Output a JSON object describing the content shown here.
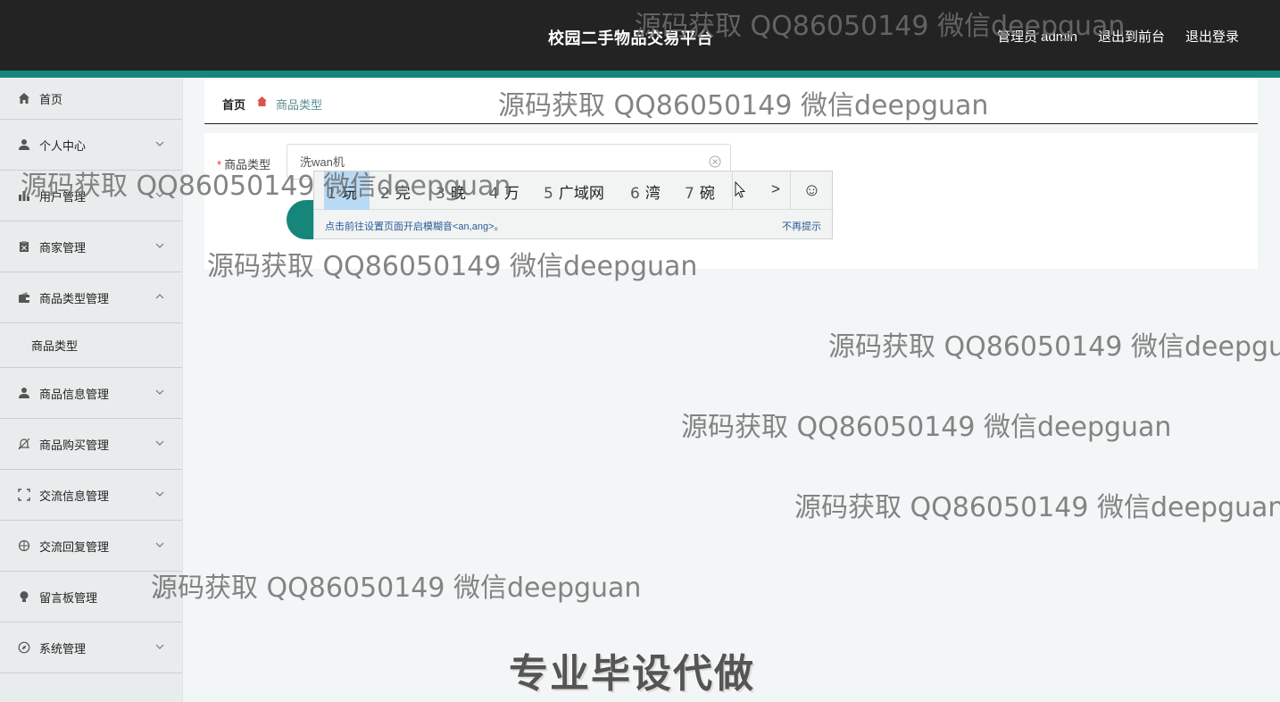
{
  "header": {
    "title": "校园二手物品交易平台",
    "links": [
      "管理员 admin",
      "退出到前台",
      "退出登录"
    ]
  },
  "sidebar": {
    "items": [
      {
        "label": "首页",
        "icon": "home-icon"
      },
      {
        "label": "个人中心",
        "icon": "user-icon"
      },
      {
        "label": "用户管理",
        "icon": "bar-chart-icon"
      },
      {
        "label": "商家管理",
        "icon": "clipboard-icon"
      },
      {
        "label": "商品类型管理",
        "icon": "wallet-icon",
        "expanded": true
      },
      {
        "label": "商品信息管理",
        "icon": "user-icon"
      },
      {
        "label": "商品购买管理",
        "icon": "bell-off-icon"
      },
      {
        "label": "交流信息管理",
        "icon": "frame-icon"
      },
      {
        "label": "交流回复管理",
        "icon": "target-icon"
      },
      {
        "label": "留言板管理",
        "icon": "bulb-icon"
      },
      {
        "label": "系统管理",
        "icon": "compass-icon"
      }
    ],
    "submenu": {
      "label": "商品类型"
    }
  },
  "breadcrumb": {
    "home": "首页",
    "current": "商品类型"
  },
  "form": {
    "label": "商品类型",
    "required_mark": "*",
    "input_value": "洗wan机"
  },
  "ime": {
    "candidates": [
      {
        "n": "1",
        "text": "玩"
      },
      {
        "n": "2",
        "text": "完"
      },
      {
        "n": "3",
        "text": "晚"
      },
      {
        "n": "4",
        "text": "万"
      },
      {
        "n": "5",
        "text": "广域网"
      },
      {
        "n": "6",
        "text": "湾"
      },
      {
        "n": "7",
        "text": "碗"
      }
    ],
    "next": ">",
    "emoji": "☺",
    "hint": "点击前往设置页面开启模糊音<an,ang>。",
    "no_prompt": "不再提示"
  },
  "watermark": {
    "text": "源码获取 QQ86050149 微信deepguan",
    "big": "专业毕设代做"
  },
  "colors": {
    "accent": "#16867b",
    "header_bg": "#222322",
    "sidebar_bg": "#e9ecec"
  }
}
